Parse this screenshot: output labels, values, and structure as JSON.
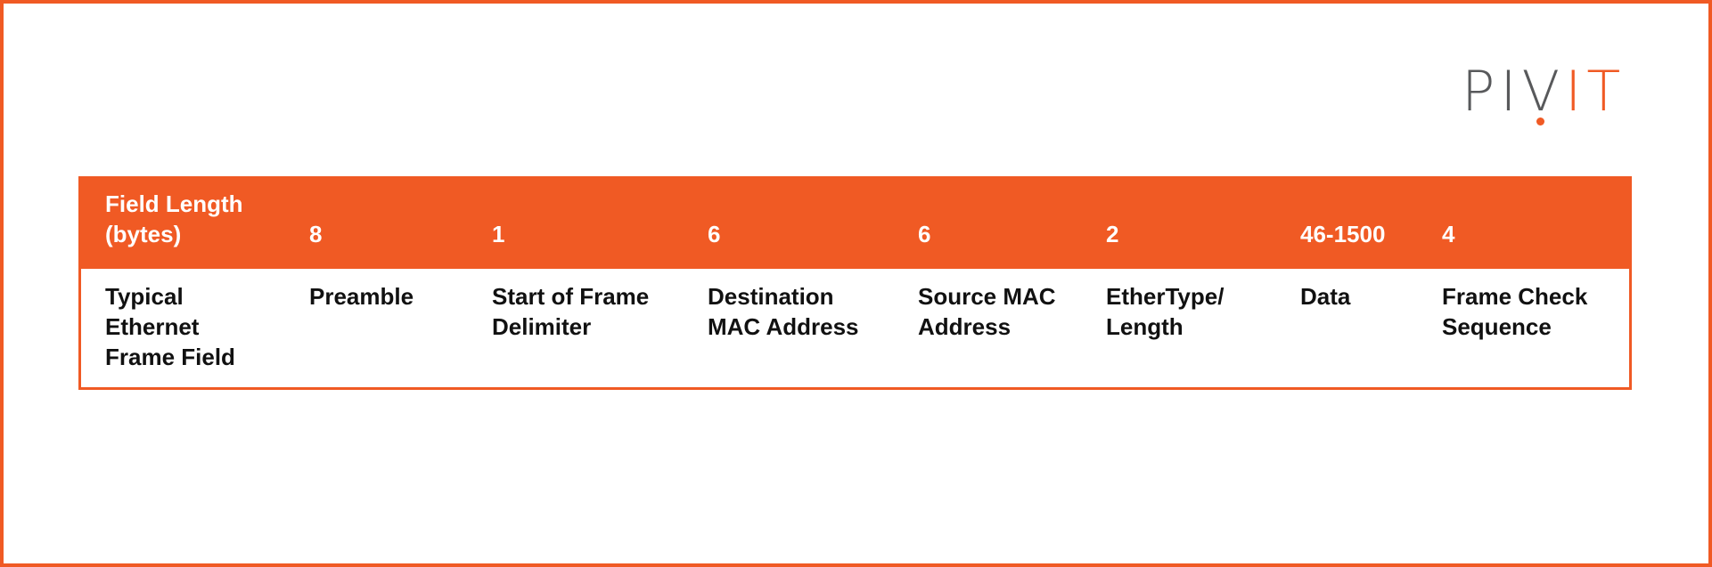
{
  "logo": {
    "left": "PIV",
    "right": "IT"
  },
  "table": {
    "header_label": [
      "Field Length",
      "(bytes)"
    ],
    "row_label": [
      "Typical",
      "Ethernet",
      "Frame Field"
    ],
    "columns": [
      {
        "length": "8",
        "field": [
          "Preamble"
        ]
      },
      {
        "length": "1",
        "field": [
          "Start of Frame",
          "Delimiter"
        ]
      },
      {
        "length": "6",
        "field": [
          "Destination",
          "MAC Address"
        ]
      },
      {
        "length": "6",
        "field": [
          "Source MAC",
          "Address"
        ]
      },
      {
        "length": "2",
        "field": [
          "EtherType/",
          "Length"
        ]
      },
      {
        "length": "46-1500",
        "field": [
          "Data"
        ]
      },
      {
        "length": "4",
        "field": [
          "Frame Check",
          "Sequence"
        ]
      }
    ]
  },
  "colors": {
    "accent": "#F05A24",
    "logo_gray": "#58595B"
  }
}
